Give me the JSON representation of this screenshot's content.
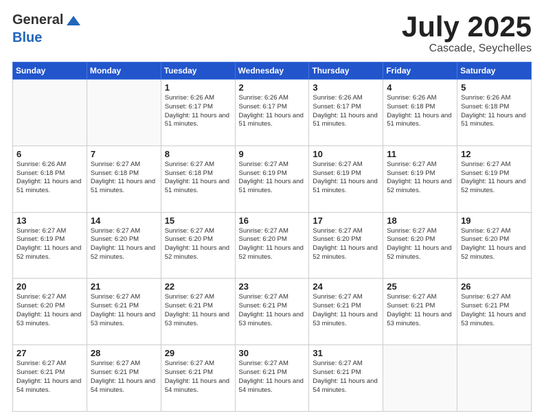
{
  "header": {
    "logo_general": "General",
    "logo_blue": "Blue",
    "title": "July 2025",
    "location": "Cascade, Seychelles"
  },
  "weekdays": [
    "Sunday",
    "Monday",
    "Tuesday",
    "Wednesday",
    "Thursday",
    "Friday",
    "Saturday"
  ],
  "weeks": [
    [
      {
        "day": "",
        "sunrise": "",
        "sunset": "",
        "daylight": "",
        "empty": true
      },
      {
        "day": "",
        "sunrise": "",
        "sunset": "",
        "daylight": "",
        "empty": true
      },
      {
        "day": "1",
        "sunrise": "Sunrise: 6:26 AM",
        "sunset": "Sunset: 6:17 PM",
        "daylight": "Daylight: 11 hours and 51 minutes."
      },
      {
        "day": "2",
        "sunrise": "Sunrise: 6:26 AM",
        "sunset": "Sunset: 6:17 PM",
        "daylight": "Daylight: 11 hours and 51 minutes."
      },
      {
        "day": "3",
        "sunrise": "Sunrise: 6:26 AM",
        "sunset": "Sunset: 6:17 PM",
        "daylight": "Daylight: 11 hours and 51 minutes."
      },
      {
        "day": "4",
        "sunrise": "Sunrise: 6:26 AM",
        "sunset": "Sunset: 6:18 PM",
        "daylight": "Daylight: 11 hours and 51 minutes."
      },
      {
        "day": "5",
        "sunrise": "Sunrise: 6:26 AM",
        "sunset": "Sunset: 6:18 PM",
        "daylight": "Daylight: 11 hours and 51 minutes."
      }
    ],
    [
      {
        "day": "6",
        "sunrise": "Sunrise: 6:26 AM",
        "sunset": "Sunset: 6:18 PM",
        "daylight": "Daylight: 11 hours and 51 minutes."
      },
      {
        "day": "7",
        "sunrise": "Sunrise: 6:27 AM",
        "sunset": "Sunset: 6:18 PM",
        "daylight": "Daylight: 11 hours and 51 minutes."
      },
      {
        "day": "8",
        "sunrise": "Sunrise: 6:27 AM",
        "sunset": "Sunset: 6:18 PM",
        "daylight": "Daylight: 11 hours and 51 minutes."
      },
      {
        "day": "9",
        "sunrise": "Sunrise: 6:27 AM",
        "sunset": "Sunset: 6:19 PM",
        "daylight": "Daylight: 11 hours and 51 minutes."
      },
      {
        "day": "10",
        "sunrise": "Sunrise: 6:27 AM",
        "sunset": "Sunset: 6:19 PM",
        "daylight": "Daylight: 11 hours and 51 minutes."
      },
      {
        "day": "11",
        "sunrise": "Sunrise: 6:27 AM",
        "sunset": "Sunset: 6:19 PM",
        "daylight": "Daylight: 11 hours and 52 minutes."
      },
      {
        "day": "12",
        "sunrise": "Sunrise: 6:27 AM",
        "sunset": "Sunset: 6:19 PM",
        "daylight": "Daylight: 11 hours and 52 minutes."
      }
    ],
    [
      {
        "day": "13",
        "sunrise": "Sunrise: 6:27 AM",
        "sunset": "Sunset: 6:19 PM",
        "daylight": "Daylight: 11 hours and 52 minutes."
      },
      {
        "day": "14",
        "sunrise": "Sunrise: 6:27 AM",
        "sunset": "Sunset: 6:20 PM",
        "daylight": "Daylight: 11 hours and 52 minutes."
      },
      {
        "day": "15",
        "sunrise": "Sunrise: 6:27 AM",
        "sunset": "Sunset: 6:20 PM",
        "daylight": "Daylight: 11 hours and 52 minutes."
      },
      {
        "day": "16",
        "sunrise": "Sunrise: 6:27 AM",
        "sunset": "Sunset: 6:20 PM",
        "daylight": "Daylight: 11 hours and 52 minutes."
      },
      {
        "day": "17",
        "sunrise": "Sunrise: 6:27 AM",
        "sunset": "Sunset: 6:20 PM",
        "daylight": "Daylight: 11 hours and 52 minutes."
      },
      {
        "day": "18",
        "sunrise": "Sunrise: 6:27 AM",
        "sunset": "Sunset: 6:20 PM",
        "daylight": "Daylight: 11 hours and 52 minutes."
      },
      {
        "day": "19",
        "sunrise": "Sunrise: 6:27 AM",
        "sunset": "Sunset: 6:20 PM",
        "daylight": "Daylight: 11 hours and 52 minutes."
      }
    ],
    [
      {
        "day": "20",
        "sunrise": "Sunrise: 6:27 AM",
        "sunset": "Sunset: 6:20 PM",
        "daylight": "Daylight: 11 hours and 53 minutes."
      },
      {
        "day": "21",
        "sunrise": "Sunrise: 6:27 AM",
        "sunset": "Sunset: 6:21 PM",
        "daylight": "Daylight: 11 hours and 53 minutes."
      },
      {
        "day": "22",
        "sunrise": "Sunrise: 6:27 AM",
        "sunset": "Sunset: 6:21 PM",
        "daylight": "Daylight: 11 hours and 53 minutes."
      },
      {
        "day": "23",
        "sunrise": "Sunrise: 6:27 AM",
        "sunset": "Sunset: 6:21 PM",
        "daylight": "Daylight: 11 hours and 53 minutes."
      },
      {
        "day": "24",
        "sunrise": "Sunrise: 6:27 AM",
        "sunset": "Sunset: 6:21 PM",
        "daylight": "Daylight: 11 hours and 53 minutes."
      },
      {
        "day": "25",
        "sunrise": "Sunrise: 6:27 AM",
        "sunset": "Sunset: 6:21 PM",
        "daylight": "Daylight: 11 hours and 53 minutes."
      },
      {
        "day": "26",
        "sunrise": "Sunrise: 6:27 AM",
        "sunset": "Sunset: 6:21 PM",
        "daylight": "Daylight: 11 hours and 53 minutes."
      }
    ],
    [
      {
        "day": "27",
        "sunrise": "Sunrise: 6:27 AM",
        "sunset": "Sunset: 6:21 PM",
        "daylight": "Daylight: 11 hours and 54 minutes."
      },
      {
        "day": "28",
        "sunrise": "Sunrise: 6:27 AM",
        "sunset": "Sunset: 6:21 PM",
        "daylight": "Daylight: 11 hours and 54 minutes."
      },
      {
        "day": "29",
        "sunrise": "Sunrise: 6:27 AM",
        "sunset": "Sunset: 6:21 PM",
        "daylight": "Daylight: 11 hours and 54 minutes."
      },
      {
        "day": "30",
        "sunrise": "Sunrise: 6:27 AM",
        "sunset": "Sunset: 6:21 PM",
        "daylight": "Daylight: 11 hours and 54 minutes."
      },
      {
        "day": "31",
        "sunrise": "Sunrise: 6:27 AM",
        "sunset": "Sunset: 6:21 PM",
        "daylight": "Daylight: 11 hours and 54 minutes."
      },
      {
        "day": "",
        "sunrise": "",
        "sunset": "",
        "daylight": "",
        "empty": true
      },
      {
        "day": "",
        "sunrise": "",
        "sunset": "",
        "daylight": "",
        "empty": true
      }
    ]
  ]
}
